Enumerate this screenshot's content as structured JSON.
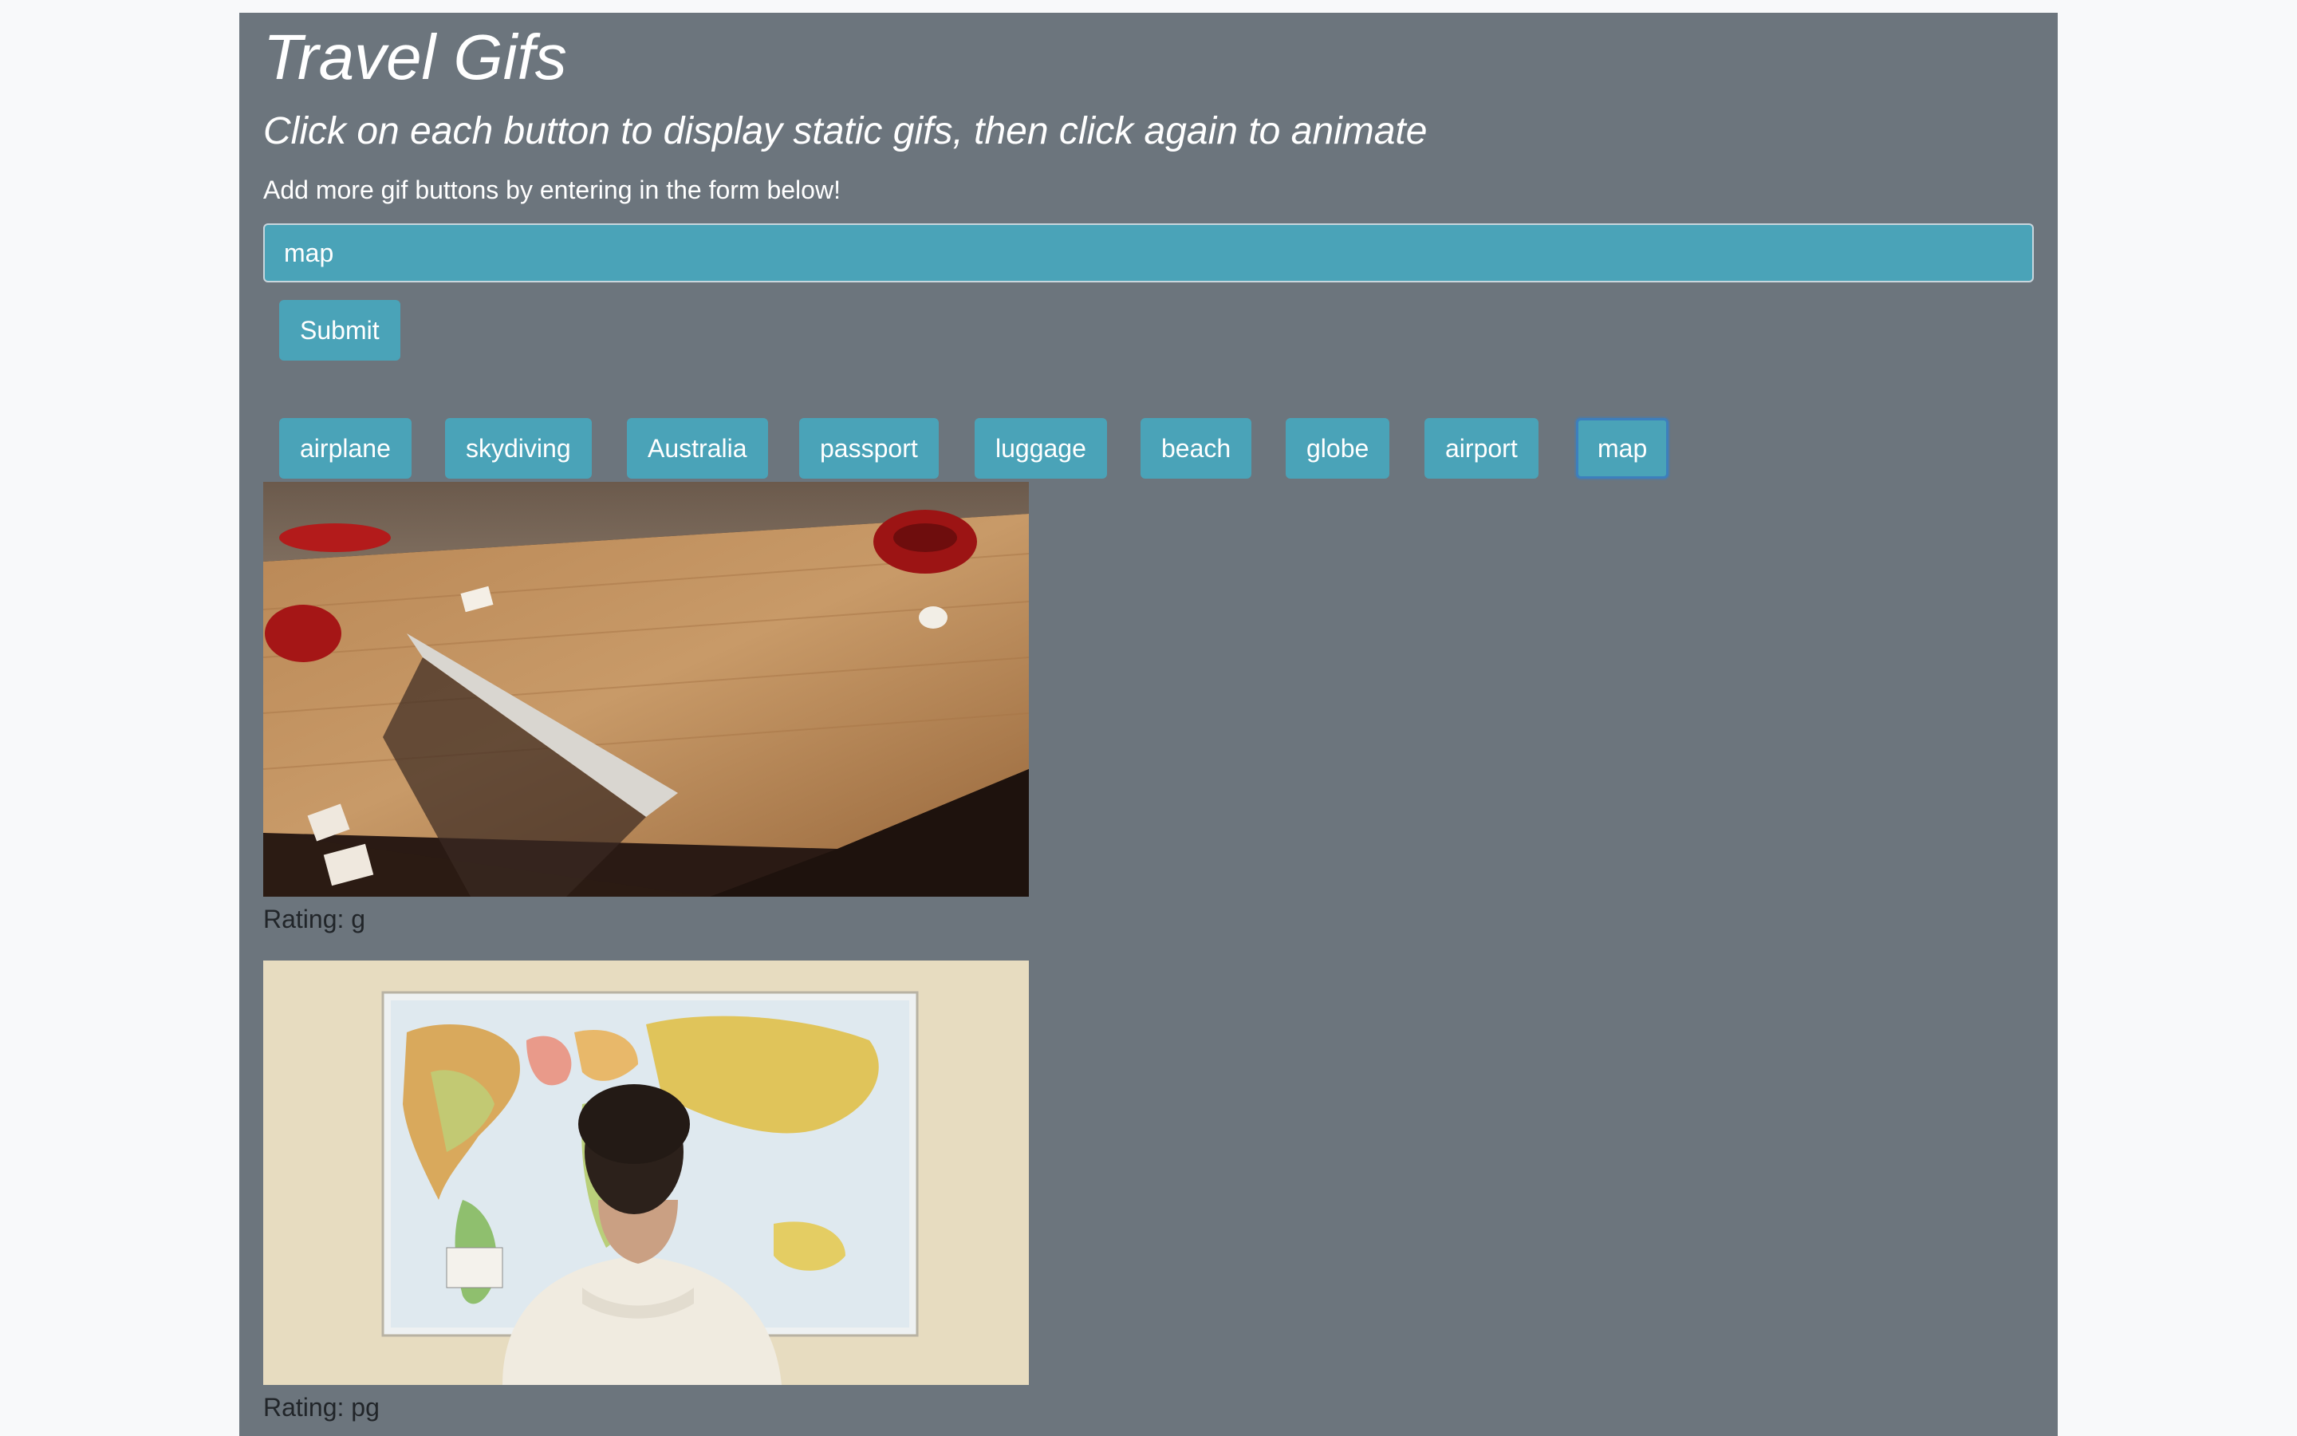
{
  "header": {
    "title": "Travel Gifs",
    "subtitle": "Click on each button to display static gifs, then click again to animate",
    "instructions": "Add more gif buttons by entering in the form below!"
  },
  "form": {
    "input_value": "map",
    "submit_label": "Submit"
  },
  "topic_buttons": [
    {
      "label": "airplane"
    },
    {
      "label": "skydiving"
    },
    {
      "label": "Australia"
    },
    {
      "label": "passport"
    },
    {
      "label": "luggage"
    },
    {
      "label": "beach"
    },
    {
      "label": "globe"
    },
    {
      "label": "airport"
    },
    {
      "label": "map",
      "active": true
    }
  ],
  "gifs": [
    {
      "rating_text": "Rating: g"
    },
    {
      "rating_text": "Rating: pg"
    }
  ],
  "colors": {
    "background": "#f8f9fa",
    "container": "#6c757d",
    "button": "#4aa3b8",
    "active_border": "#3d7fbd",
    "text_light": "#ffffff",
    "text_dark": "#212529"
  }
}
